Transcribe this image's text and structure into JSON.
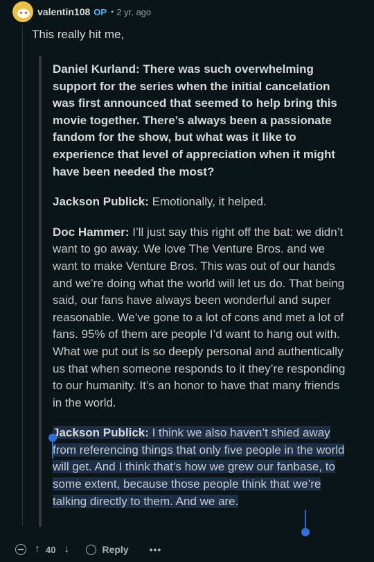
{
  "comment": {
    "username": "valentin108",
    "op_badge": "OP",
    "separator": "•",
    "age": "2 yr. ago",
    "lead_text": "This really hit me,"
  },
  "quote": {
    "q1": "Daniel Kurland: There was such overwhelming support for the series when the initial cancelation was first announced that seemed to help bring this movie together. There’s always been a passionate fandom for the show, but what was it like to experience that level of appreciation when it might have been needed the most?",
    "p2_speaker": "Jackson Publick:",
    "p2_text": " Emotionally, it helped.",
    "p3_speaker": "Doc Hammer:",
    "p3_text": " I’ll just say this right off the bat: we didn’t want to go away. We love The Venture Bros. and we want to make Venture Bros. This was out of our hands and we’re doing what the world will let us do. That being said, our fans have always been wonderful and super reasonable. We’ve gone to a lot of cons and met a lot of fans. 95% of them are people I’d want to hang out with. What we put out is so deeply personal and authentically us that when someone responds to it they’re responding to our humanity. It’s an honor to have that many friends in the world.",
    "p4_speaker": "Jackson Publick:",
    "p4_text": " I think we also haven’t shied away from referencing things that only five people in the world will get. And I think that’s how we grew our fanbase, to some extent, because those people think that we’re talking directly to them. And we are."
  },
  "actions": {
    "upvote_icon": "↑",
    "score": "40",
    "downvote_icon": "↓",
    "reply_label": "Reply",
    "more_label": "•••"
  },
  "colors": {
    "background": "#0b1416",
    "op_badge": "#4fbcff",
    "selection": "#1c2f46",
    "selection_handle": "#2f6fd6"
  }
}
